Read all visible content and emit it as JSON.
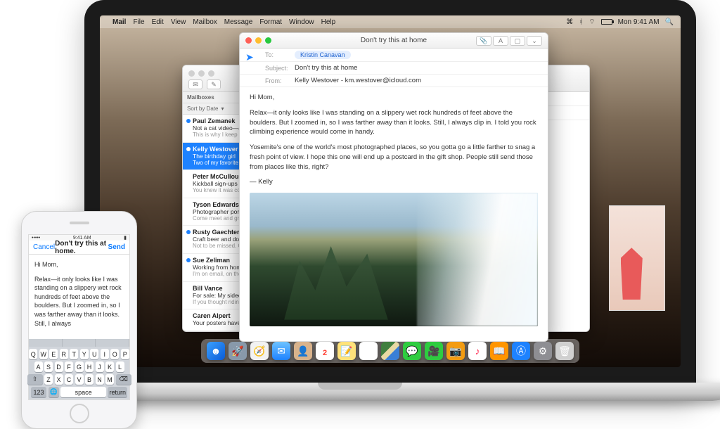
{
  "menubar": {
    "apple": "",
    "app": "Mail",
    "items": [
      "File",
      "Edit",
      "View",
      "Mailbox",
      "Message",
      "Format",
      "Window",
      "Help"
    ],
    "right": {
      "time": "Mon 9:41 AM"
    }
  },
  "mailwin": {
    "sort_label": "Sort by Date",
    "mailboxes_label": "Mailboxes",
    "messages": [
      {
        "from": "Paul Zemanek",
        "subj": "Not a cat video—a mo",
        "prev": "This is why I keep my park. Astro, a shepher",
        "unread": true,
        "selected": false
      },
      {
        "from": "Kelly Westover",
        "subj": "The birthday girl",
        "prev": "Two of my favorite fo celebrate with you. T",
        "unread": true,
        "selected": true
      },
      {
        "from": "Peter McCullough",
        "subj": "Kickball sign-ups",
        "prev": "You knew it was com players, rookie playe",
        "unread": false,
        "selected": false
      },
      {
        "from": "Tyson Edwards",
        "subj": "Photographer portfolio",
        "prev": "Come meet and greet great shooters. There",
        "unread": false,
        "selected": false
      },
      {
        "from": "Rusty Gaechter",
        "subj": "Craft beer and donut",
        "prev": "Not to be missed. Co each sample is paired",
        "unread": true,
        "selected": false
      },
      {
        "from": "Sue Zeliman",
        "subj": "Working from home",
        "prev": "I'm on email, on the p work, but I'm not ther",
        "unread": true,
        "selected": false
      },
      {
        "from": "Bill Vance",
        "subj": "For sale: My sidecar m",
        "prev": "If you thought riding i try this. And you can b",
        "unread": false,
        "selected": false
      },
      {
        "from": "Caren Alpert",
        "subj": "Your posters have shi",
        "prev": "",
        "unread": false,
        "selected": false
      }
    ]
  },
  "compose": {
    "title": "Don't try this at home",
    "to_label": "To:",
    "to_name": "Kristin Canavan",
    "subject_label": "Subject:",
    "subject": "Don't try this at home",
    "from_label": "From:",
    "from": "Kelly Westover - km.westover@icloud.com",
    "body_greeting": "Hi Mom,",
    "body_p1": "Relax—it only looks like I was standing on a slippery wet rock hundreds of feet above the boulders. But I zoomed in, so I was farther away than it looks. Still, I always clip in. I told you rock climbing experience would come in handy.",
    "body_p2": "Yosemite's one of the world's most photographed places, so you gotta go a little farther to snag a fresh point of view. I hope this one will end up a postcard in the gift shop. People still send those from places like this, right?",
    "body_sig": "— Kelly"
  },
  "dock": {
    "cal_day": "2",
    "items": [
      "finder",
      "launchpad",
      "safari",
      "mail",
      "contacts",
      "calendar",
      "notes",
      "reminders",
      "maps",
      "messages",
      "facetime",
      "photobooth",
      "itunes",
      "ibooks",
      "appstore",
      "preferences",
      "trash"
    ]
  },
  "phone": {
    "status_time": "9:41 AM",
    "cancel": "Cancel",
    "title": "Don't try this at home.",
    "send": "Send",
    "greeting": "Hi Mom,",
    "body": "Relax—it only looks like I was standing on a slippery wet rock hundreds of feet above the boulders. But I zoomed in, so I was farther away than it looks. Still, I always",
    "keyboard": {
      "row1": [
        "Q",
        "W",
        "E",
        "R",
        "T",
        "Y",
        "U",
        "I",
        "O",
        "P"
      ],
      "row2": [
        "A",
        "S",
        "D",
        "F",
        "G",
        "H",
        "J",
        "K",
        "L"
      ],
      "row3": [
        "⇧",
        "Z",
        "X",
        "C",
        "V",
        "B",
        "N",
        "M",
        "⌫"
      ],
      "row4_123": "123",
      "row4_globe": "🌐",
      "row4_space": "space",
      "row4_return": "return"
    }
  }
}
